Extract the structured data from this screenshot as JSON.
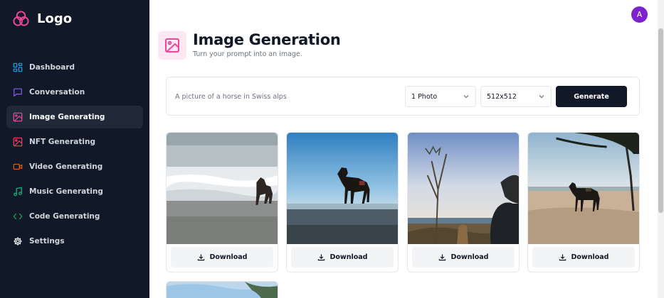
{
  "sidebar": {
    "logo_text": "Logo",
    "items": [
      {
        "label": "Dashboard",
        "icon": "dashboard-icon",
        "color": "#0ea5e9"
      },
      {
        "label": "Conversation",
        "icon": "chat-icon",
        "color": "#8b5cf6"
      },
      {
        "label": "Image Generating",
        "icon": "image-icon",
        "color": "#ec4899",
        "active": true
      },
      {
        "label": "NFT Generating",
        "icon": "image-icon",
        "color": "#f43f5e"
      },
      {
        "label": "Video Generating",
        "icon": "video-icon",
        "color": "#ea580c"
      },
      {
        "label": "Music Generating",
        "icon": "music-icon",
        "color": "#10b981"
      },
      {
        "label": "Code Generating",
        "icon": "code-icon",
        "color": "#16a34a"
      },
      {
        "label": "Settings",
        "icon": "gear-icon",
        "color": "#ffffff"
      }
    ]
  },
  "header": {
    "avatar_initial": "A",
    "title": "Image Generation",
    "subtitle": "Turn your prompt into an image."
  },
  "form": {
    "prompt_placeholder": "A picture of a horse in Swiss alps",
    "prompt_value": "",
    "count_selected": "1 Photo",
    "size_selected": "512x512",
    "generate_label": "Generate"
  },
  "results": {
    "download_label": "Download",
    "images": [
      "horse on beach with waves",
      "horse silhouette on beach",
      "person and horse under tree",
      "horse under tree on beach",
      "horse on beach"
    ]
  },
  "colors": {
    "sidebar_bg": "#111827",
    "accent_pink": "#ec4899",
    "button_dark": "#111827"
  }
}
